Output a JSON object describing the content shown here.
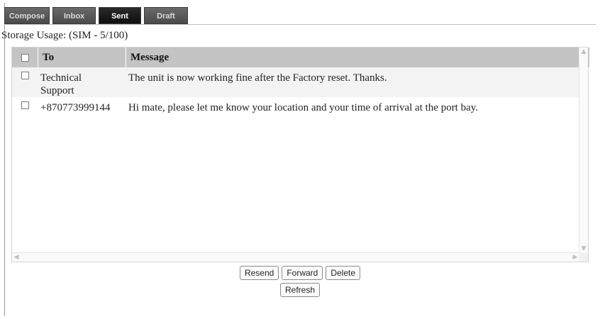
{
  "tabs": [
    {
      "label": "Compose",
      "active": false
    },
    {
      "label": "Inbox",
      "active": false
    },
    {
      "label": "Sent",
      "active": true
    },
    {
      "label": "Draft",
      "active": false
    }
  ],
  "storage_usage": "Storage Usage: (SIM - 5/100)",
  "table": {
    "headers": {
      "to": "To",
      "message": "Message"
    },
    "rows": [
      {
        "to_line1": "Technical",
        "to_line2": "Support",
        "message": "The unit is now working fine after the Factory reset. Thanks."
      },
      {
        "to_line1": "+870773999144",
        "to_line2": "",
        "message": "Hi mate, please let me know your location and your time of arrival at the port bay."
      }
    ]
  },
  "buttons": {
    "resend": "Resend",
    "forward": "Forward",
    "delete": "Delete",
    "refresh": "Refresh"
  },
  "colors": {
    "tab_bg": "#4a4a4a",
    "tab_active_bg": "#0e0e0e",
    "header_bg": "#c4c4c4",
    "row_alt_bg": "#f3f3f3"
  }
}
